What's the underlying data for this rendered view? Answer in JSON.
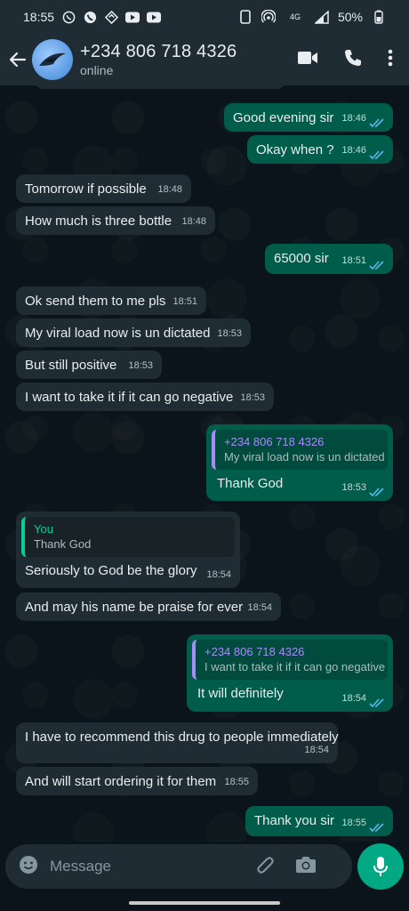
{
  "status_bar": {
    "time": "18:55",
    "network": "4G",
    "battery": "50%"
  },
  "header": {
    "contact_name": "+234 806 718 4326",
    "contact_status": "online"
  },
  "messages": [
    {
      "dir": "out",
      "text": "Good evening sir",
      "time": "18:46"
    },
    {
      "dir": "out",
      "text": "Okay when ?",
      "time": "18:46"
    },
    {
      "dir": "in",
      "text": "Tomorrow if possible",
      "time": "18:48"
    },
    {
      "dir": "in",
      "text": "How much is three bottle",
      "time": "18:48"
    },
    {
      "dir": "out",
      "text": "65000 sir",
      "time": "18:51"
    },
    {
      "dir": "in",
      "text": "Ok send them to me pls",
      "time": "18:51"
    },
    {
      "dir": "in",
      "text": "My viral load now is un dictated",
      "time": "18:53"
    },
    {
      "dir": "in",
      "text": "But still positive",
      "time": "18:53"
    },
    {
      "dir": "in",
      "text": "I want to take it if it can go negative",
      "time": "18:53"
    },
    {
      "dir": "out",
      "quote_name": "+234 806 718 4326",
      "quote_text": "My viral load now is un dictated",
      "text": "Thank God",
      "time": "18:53"
    },
    {
      "dir": "in",
      "quote_name": "You",
      "quote_text": "Thank God",
      "text": "Seriously to God be the glory",
      "time": "18:54"
    },
    {
      "dir": "in",
      "text": "And may his name be praise for ever",
      "time": "18:54"
    },
    {
      "dir": "out",
      "quote_name": "+234 806 718 4326",
      "quote_text": "I want to take it if it can go negative",
      "text": "It will definitely",
      "time": "18:54"
    },
    {
      "dir": "in",
      "text": "I have to recommend this drug to people immediately",
      "time": "18:54"
    },
    {
      "dir": "in",
      "text": "And will start ordering it for them",
      "time": "18:55"
    },
    {
      "dir": "out",
      "text": "Thank you sir",
      "time": "18:55"
    }
  ],
  "input": {
    "placeholder": "Message"
  },
  "colors": {
    "accent": "#00a884",
    "outgoing_bubble": "#005c4b",
    "incoming_bubble": "#202c33",
    "read_ticks": "#53bdeb"
  },
  "icons": {
    "back": "arrow-left-icon",
    "video": "video-call-icon",
    "call": "phone-icon",
    "menu": "more-vertical-icon",
    "emoji": "emoji-icon",
    "attach": "paperclip-icon",
    "camera": "camera-icon",
    "mic": "microphone-icon"
  }
}
